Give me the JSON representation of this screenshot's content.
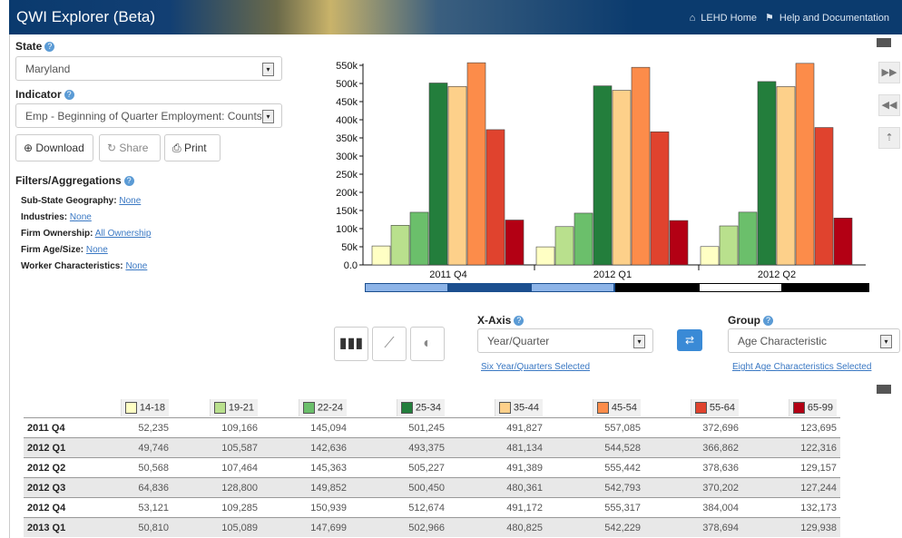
{
  "app": {
    "title": "QWI Explorer (Beta)",
    "link_home": "LEHD Home",
    "link_help": "Help and Documentation"
  },
  "state": {
    "label": "State",
    "value": "Maryland"
  },
  "indicator": {
    "label": "Indicator",
    "value": "Emp - Beginning of Quarter Employment: Counts"
  },
  "actions": {
    "download": "Download",
    "share": "Share",
    "print": "Print"
  },
  "filters": {
    "title": "Filters/Aggregations",
    "rows": [
      {
        "label": "Sub-State Geography:",
        "value": "None"
      },
      {
        "label": "Industries:",
        "value": "None"
      },
      {
        "label": "Firm Ownership:",
        "value": "All Ownership"
      },
      {
        "label": "Firm Age/Size:",
        "value": "None"
      },
      {
        "label": "Worker Characteristics:",
        "value": "None"
      }
    ]
  },
  "xaxis": {
    "label": "X-Axis",
    "value": "Year/Quarter",
    "link": "Six Year/Quarters Selected"
  },
  "group": {
    "label": "Group",
    "value": "Age Characteristic",
    "link": "Eight Age Characteristics Selected"
  },
  "colors": {
    "14-18": "#ffffc4",
    "19-21": "#b9e08d",
    "22-24": "#6bbf6b",
    "25-34": "#237e3c",
    "35-44": "#fdd08a",
    "45-54": "#fc8c4a",
    "55-64": "#e0432e",
    "65-99": "#b30014"
  },
  "chart_data": {
    "type": "bar",
    "categories": [
      "2011 Q4",
      "2012 Q1",
      "2012 Q2"
    ],
    "ylim": [
      0,
      550000
    ],
    "yticks": [
      "0.0",
      "50k",
      "100k",
      "150k",
      "200k",
      "250k",
      "300k",
      "350k",
      "400k",
      "450k",
      "500k",
      "550k"
    ],
    "series": [
      {
        "name": "14-18",
        "values": [
          52235,
          49746,
          50568
        ]
      },
      {
        "name": "19-21",
        "values": [
          109166,
          105587,
          107464
        ]
      },
      {
        "name": "22-24",
        "values": [
          145094,
          142636,
          145363
        ]
      },
      {
        "name": "25-34",
        "values": [
          501245,
          493375,
          505227
        ]
      },
      {
        "name": "35-44",
        "values": [
          491827,
          481134,
          491389
        ]
      },
      {
        "name": "45-54",
        "values": [
          557085,
          544528,
          555442
        ]
      },
      {
        "name": "55-64",
        "values": [
          372696,
          366862,
          378636
        ]
      },
      {
        "name": "65-99",
        "values": [
          123695,
          122316,
          129157
        ]
      }
    ]
  },
  "table": {
    "columns": [
      "14-18",
      "19-21",
      "22-24",
      "25-34",
      "35-44",
      "45-54",
      "55-64",
      "65-99"
    ],
    "rows": [
      {
        "label": "2011 Q4",
        "cells": [
          "52,235",
          "109,166",
          "145,094",
          "501,245",
          "491,827",
          "557,085",
          "372,696",
          "123,695"
        ]
      },
      {
        "label": "2012 Q1",
        "cells": [
          "49,746",
          "105,587",
          "142,636",
          "493,375",
          "481,134",
          "544,528",
          "366,862",
          "122,316"
        ]
      },
      {
        "label": "2012 Q2",
        "cells": [
          "50,568",
          "107,464",
          "145,363",
          "505,227",
          "491,389",
          "555,442",
          "378,636",
          "129,157"
        ]
      },
      {
        "label": "2012 Q3",
        "cells": [
          "64,836",
          "128,800",
          "149,852",
          "500,450",
          "480,361",
          "542,793",
          "370,202",
          "127,244"
        ]
      },
      {
        "label": "2012 Q4",
        "cells": [
          "53,121",
          "109,285",
          "150,939",
          "512,674",
          "491,172",
          "555,317",
          "384,004",
          "132,173"
        ]
      },
      {
        "label": "2013 Q1",
        "cells": [
          "50,810",
          "105,089",
          "147,699",
          "502,966",
          "480,825",
          "542,229",
          "378,694",
          "129,938"
        ]
      }
    ]
  }
}
